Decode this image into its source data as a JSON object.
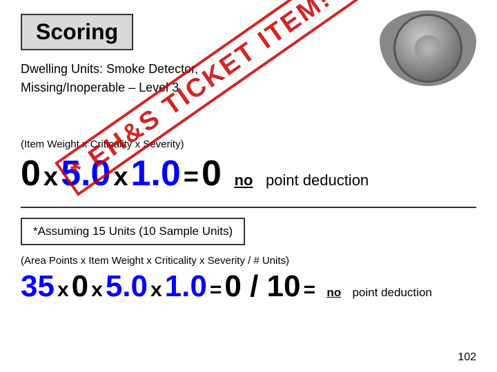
{
  "header": {
    "scoring_label": "Scoring"
  },
  "dwelling": {
    "line1": "Dwelling Units: Smoke Detector,",
    "line2": "Missing/Inoperable – Level 3"
  },
  "ticket_stamp": "* EH&S TICKET ITEM! *",
  "formula_section": {
    "label": "(Item Weight x Criticality x Severity)",
    "num1": "0",
    "op1": "x",
    "num2": "5.0",
    "op2": "x",
    "num3": "1.0",
    "op3": "=",
    "result": "0",
    "no_text": "no",
    "suffix": "point deduction"
  },
  "assuming_box": {
    "text": "*Assuming 15 Units  (10 Sample Units)"
  },
  "area_section": {
    "label": "(Area Points x Item Weight x Criticality x Severity / # Units)",
    "num1": "35",
    "op1": "x",
    "num2": "0",
    "op2": "x",
    "num3": "5.0",
    "op3": "x",
    "num4": "1.0",
    "op4": "=",
    "result": "0 / 10",
    "op5": "=",
    "no_text": "no",
    "suffix": "point deduction"
  },
  "page_number": "102"
}
